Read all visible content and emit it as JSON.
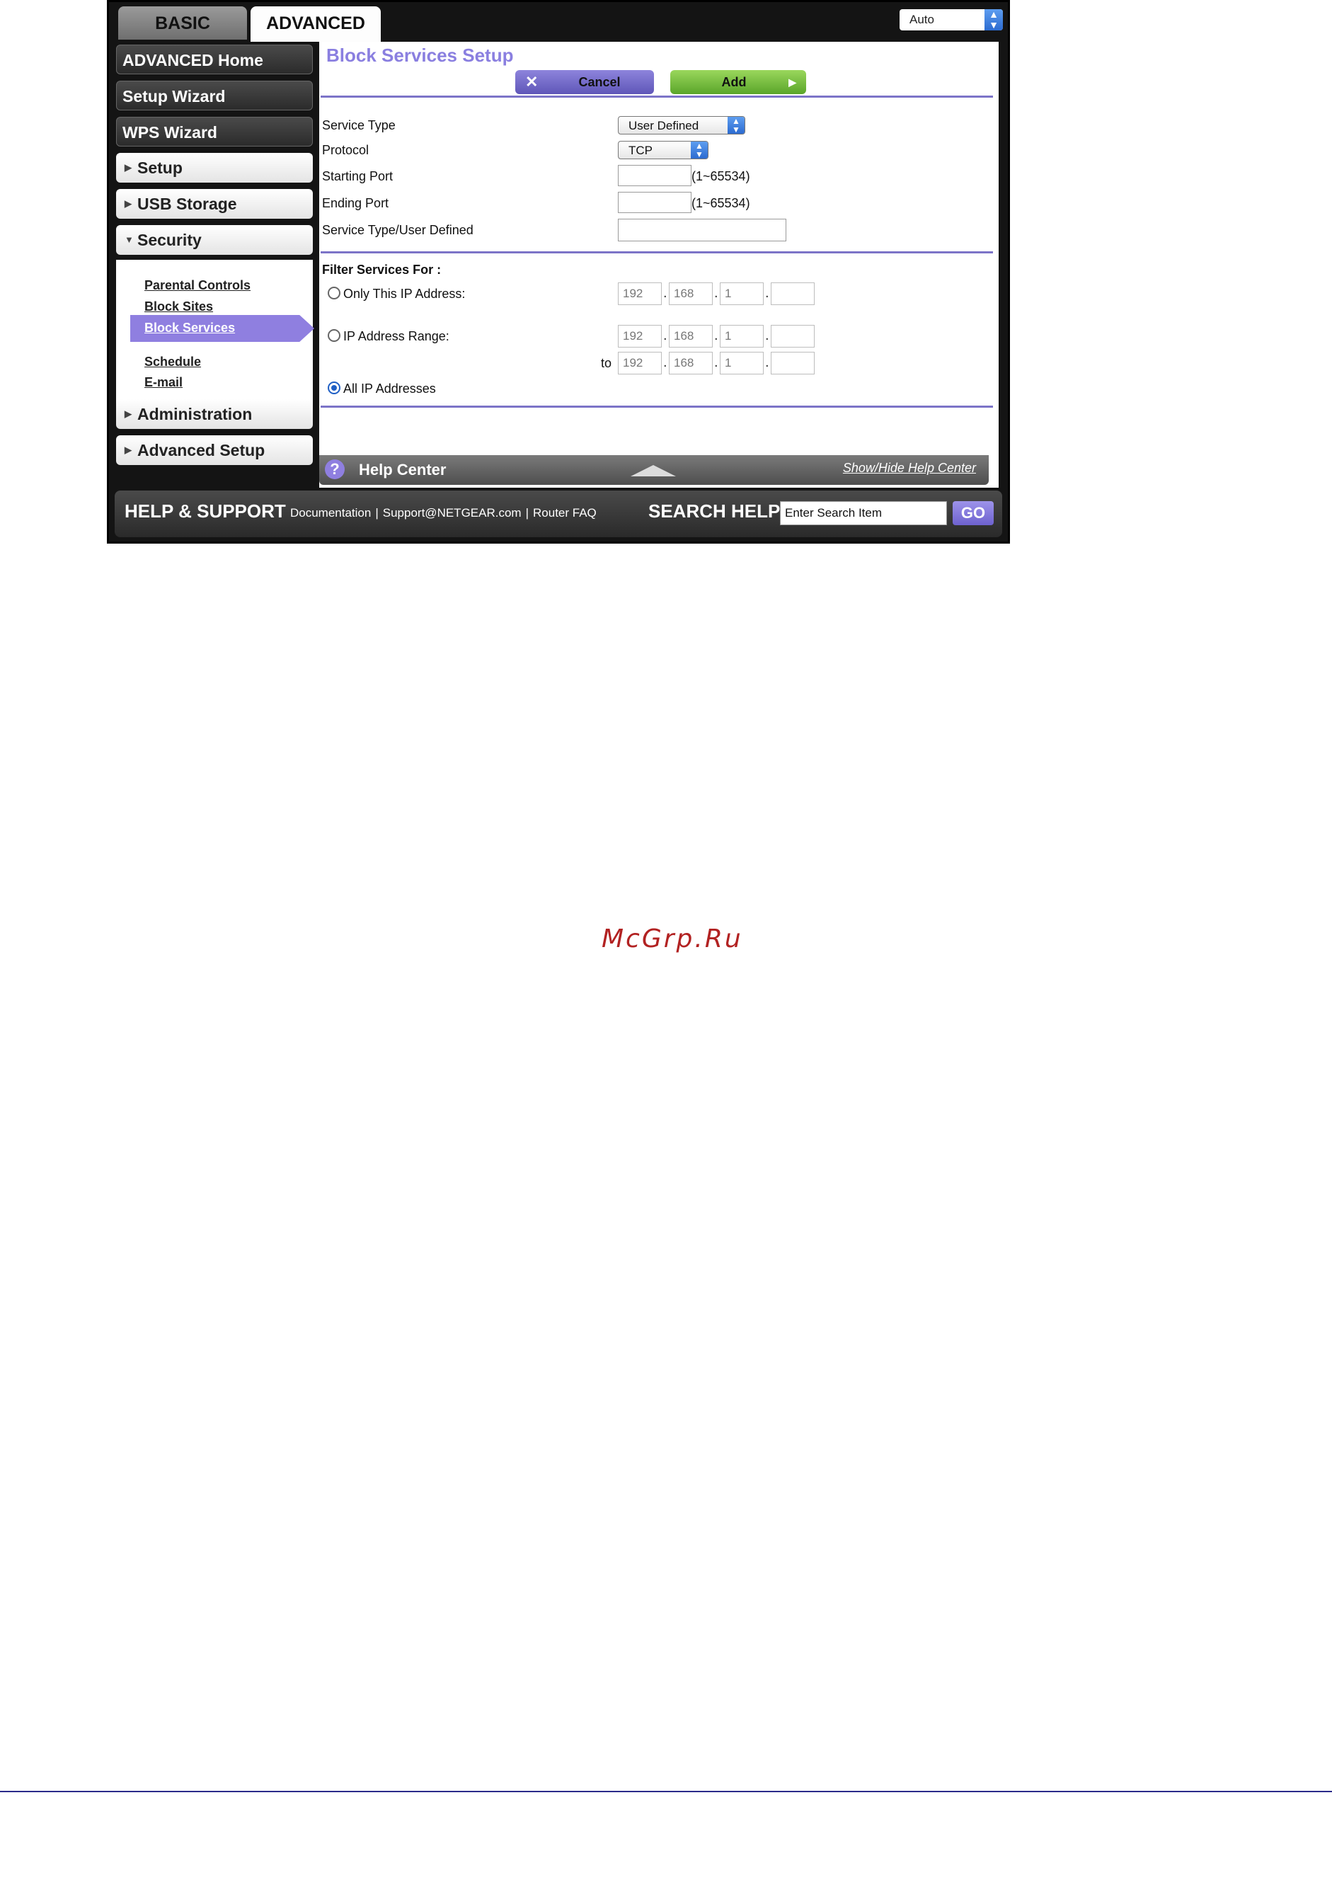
{
  "tabs": {
    "basic": "BASIC",
    "advanced": "ADVANCED"
  },
  "language_select": {
    "value": "Auto"
  },
  "sidebar": {
    "items": [
      {
        "label": "ADVANCED Home"
      },
      {
        "label": "Setup Wizard"
      },
      {
        "label": "WPS Wizard"
      },
      {
        "label": "Setup"
      },
      {
        "label": "USB Storage"
      },
      {
        "label": "Security"
      },
      {
        "label": "Administration"
      },
      {
        "label": "Advanced Setup"
      }
    ],
    "security_subitems": [
      {
        "label": "Parental Controls"
      },
      {
        "label": "Block Sites"
      },
      {
        "label": "Block Services"
      },
      {
        "label": "Schedule"
      },
      {
        "label": "E-mail"
      }
    ]
  },
  "main": {
    "title": "Block Services Setup",
    "cancel_label": "Cancel",
    "add_label": "Add",
    "form": {
      "service_type_label": "Service Type",
      "service_type_value": "User Defined",
      "protocol_label": "Protocol",
      "protocol_value": "TCP",
      "starting_port_label": "Starting Port",
      "starting_port_range": "(1~65534)",
      "ending_port_label": "Ending Port",
      "ending_port_range": "(1~65534)",
      "user_defined_label": "Service Type/User Defined"
    },
    "filter": {
      "heading": "Filter Services For :",
      "only_ip_label": "Only This IP Address:",
      "only_ip": [
        "192",
        "168",
        "1",
        ""
      ],
      "range_label": "IP Address Range:",
      "range_from": [
        "192",
        "168",
        "1",
        ""
      ],
      "range_to_label": "to",
      "range_to": [
        "192",
        "168",
        "1",
        ""
      ],
      "all_ip_label": "All IP Addresses",
      "selected": "All IP Addresses"
    }
  },
  "help_center": {
    "title": "Help Center",
    "toggle": "Show/Hide Help Center",
    "q": "?"
  },
  "footer": {
    "help_support": "HELP & SUPPORT",
    "links": [
      "Documentation",
      "Support@NETGEAR.com",
      "Router FAQ"
    ],
    "search_title": "SEARCH HELP",
    "search_value": "Enter Search Item",
    "go_label": "GO"
  },
  "watermark": "McGrp.Ru",
  "colors": {
    "accent_purple": "#8a7fe0",
    "add_green": "#6bb534",
    "frame_dark": "#141414"
  }
}
